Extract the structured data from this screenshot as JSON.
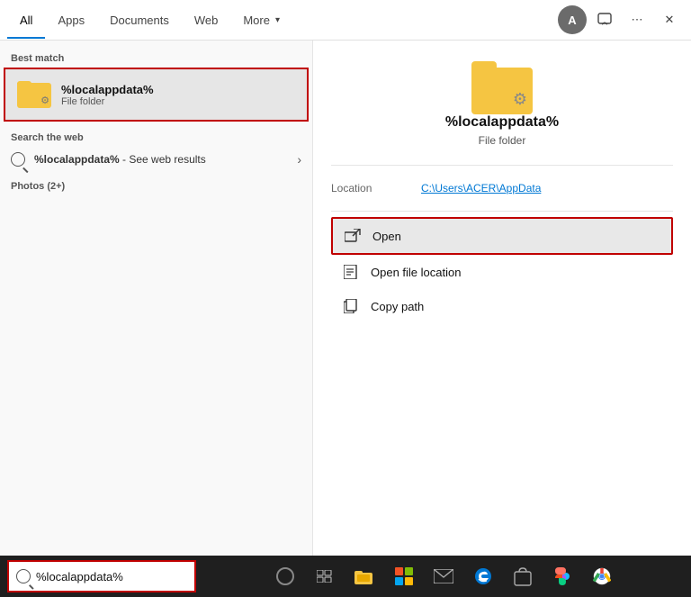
{
  "tabs": {
    "all": "All",
    "apps": "Apps",
    "documents": "Documents",
    "web": "Web",
    "more": "More",
    "active": "all"
  },
  "header": {
    "avatar_label": "A",
    "more_icon": "⋯",
    "close_icon": "✕"
  },
  "left_panel": {
    "best_match_label": "Best match",
    "best_match_item": {
      "name": "%localappdata%",
      "subtitle": "File folder"
    },
    "web_section_label": "Search the web",
    "web_item": {
      "query": "%localappdata%",
      "suffix": " - See web results"
    },
    "photos_label": "Photos (2+)"
  },
  "right_panel": {
    "item_name": "%localappdata%",
    "item_type": "File folder",
    "location_label": "Location",
    "location_value": "C:\\Users\\ACER\\AppData",
    "actions": [
      {
        "id": "open",
        "label": "Open",
        "highlighted": true
      },
      {
        "id": "open-file-location",
        "label": "Open file location",
        "highlighted": false
      },
      {
        "id": "copy-path",
        "label": "Copy path",
        "highlighted": false
      }
    ]
  },
  "taskbar": {
    "search_value": "%localappdata%",
    "search_placeholder": "%localappdata%"
  }
}
